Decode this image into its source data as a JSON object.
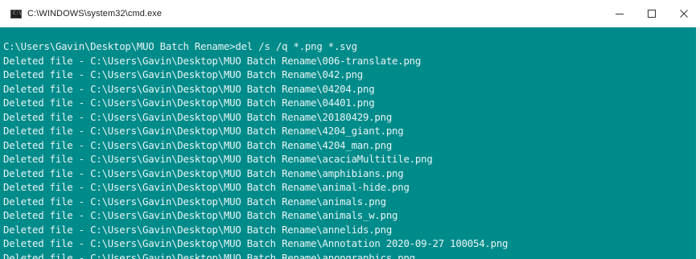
{
  "window": {
    "title": "C:\\WINDOWS\\system32\\cmd.exe",
    "icon": "cmd-icon",
    "icon_glyph": "C:\\",
    "controls": {
      "minimize": "minimize-icon",
      "maximize": "maximize-icon",
      "close": "close-icon"
    }
  },
  "colors": {
    "console_bg": "#008b8b",
    "console_fg": "#e8f4f4"
  },
  "console": {
    "lines": [
      "C:\\Users\\Gavin\\Desktop\\MUO Batch Rename>del /s /q *.png *.svg",
      "Deleted file - C:\\Users\\Gavin\\Desktop\\MUO Batch Rename\\006-translate.png",
      "Deleted file - C:\\Users\\Gavin\\Desktop\\MUO Batch Rename\\042.png",
      "Deleted file - C:\\Users\\Gavin\\Desktop\\MUO Batch Rename\\04204.png",
      "Deleted file - C:\\Users\\Gavin\\Desktop\\MUO Batch Rename\\04401.png",
      "Deleted file - C:\\Users\\Gavin\\Desktop\\MUO Batch Rename\\20180429.png",
      "Deleted file - C:\\Users\\Gavin\\Desktop\\MUO Batch Rename\\4204_giant.png",
      "Deleted file - C:\\Users\\Gavin\\Desktop\\MUO Batch Rename\\4204_man.png",
      "Deleted file - C:\\Users\\Gavin\\Desktop\\MUO Batch Rename\\acaciaMultitile.png",
      "Deleted file - C:\\Users\\Gavin\\Desktop\\MUO Batch Rename\\amphibians.png",
      "Deleted file - C:\\Users\\Gavin\\Desktop\\MUO Batch Rename\\animal-hide.png",
      "Deleted file - C:\\Users\\Gavin\\Desktop\\MUO Batch Rename\\animals.png",
      "Deleted file - C:\\Users\\Gavin\\Desktop\\MUO Batch Rename\\animals_w.png",
      "Deleted file - C:\\Users\\Gavin\\Desktop\\MUO Batch Rename\\annelids.png",
      "Deleted file - C:\\Users\\Gavin\\Desktop\\MUO Batch Rename\\Annotation 2020-09-27 100054.png",
      "Deleted file - C:\\Users\\Gavin\\Desktop\\MUO Batch Rename\\anongraphics.png"
    ]
  }
}
